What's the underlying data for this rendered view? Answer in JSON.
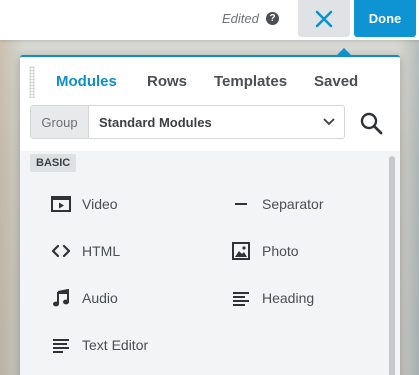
{
  "topbar": {
    "status_label": "Edited",
    "help_icon": "question-circle-icon",
    "close_icon": "close-icon",
    "done_label": "Done",
    "accent_color": "#0e93d3"
  },
  "panel": {
    "tabs": [
      {
        "label": "Modules",
        "active": true
      },
      {
        "label": "Rows",
        "active": false
      },
      {
        "label": "Templates",
        "active": false
      },
      {
        "label": "Saved",
        "active": false
      }
    ],
    "group": {
      "label": "Group",
      "value": "Standard Modules"
    },
    "search_icon": "search-icon",
    "section": {
      "title": "BASIC",
      "modules": [
        {
          "label": "Video",
          "icon": "video-icon"
        },
        {
          "label": "Separator",
          "icon": "separator-icon"
        },
        {
          "label": "HTML",
          "icon": "code-icon"
        },
        {
          "label": "Photo",
          "icon": "photo-icon"
        },
        {
          "label": "Audio",
          "icon": "music-note-icon"
        },
        {
          "label": "Heading",
          "icon": "heading-icon"
        },
        {
          "label": "Text Editor",
          "icon": "text-editor-icon"
        }
      ]
    }
  }
}
